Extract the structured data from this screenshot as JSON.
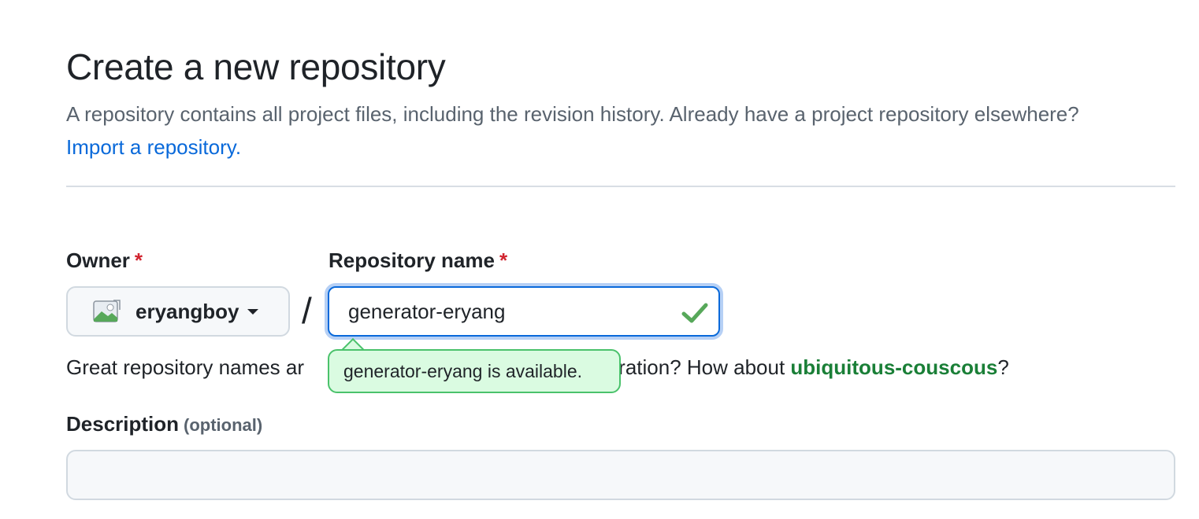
{
  "page": {
    "title": "Create a new repository",
    "subtitle_text": "A repository contains all project files, including the revision history. Already have a project repository elsewhere?",
    "import_link": "Import a repository."
  },
  "owner": {
    "label": "Owner",
    "required_mark": "*",
    "selected": "eryangboy",
    "avatar_icon": "broken-image-icon"
  },
  "separator": "/",
  "repo_name": {
    "label": "Repository name",
    "required_mark": "*",
    "value": "generator-eryang",
    "status_icon": "check-icon",
    "status_color": "#2da44e"
  },
  "availability": {
    "message": "generator-eryang is available."
  },
  "helper": {
    "prefix": "Great repository names ar",
    "suffix": "d inspiration? How about ",
    "suggestion": "ubiquitous-couscous",
    "end": "?"
  },
  "description": {
    "label": "Description",
    "optional": "(optional)",
    "value": ""
  },
  "colors": {
    "link": "#0969da",
    "success": "#1a7f37",
    "required": "#d1242f",
    "focus_border": "#0969da"
  }
}
